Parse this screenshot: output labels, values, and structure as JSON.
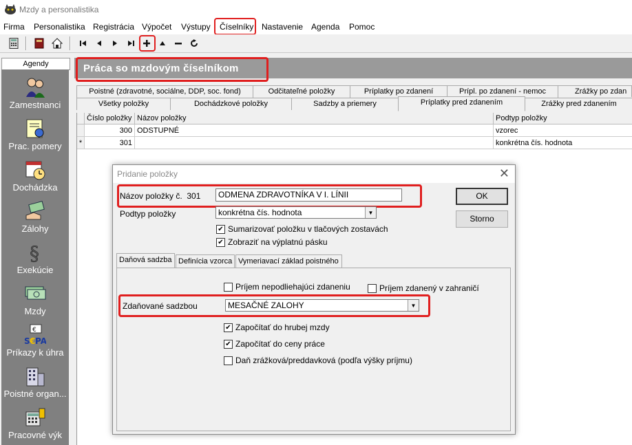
{
  "window": {
    "title": "Mzdy a personalistika"
  },
  "menu": [
    "Firma",
    "Personalistika",
    "Registrácia",
    "Výpočet",
    "Výstupy",
    "Číselníky",
    "Nastavenie",
    "Agenda",
    "Pomoc"
  ],
  "toolbar": {
    "icons": [
      "calculator-icon",
      "book-icon",
      "home-icon",
      "first-record-icon",
      "prev-record-icon",
      "next-record-icon",
      "last-record-icon",
      "add-record-icon",
      "up-record-icon",
      "delete-record-icon",
      "refresh-icon"
    ]
  },
  "sidebar": {
    "header": "Agendy",
    "items": [
      {
        "label": "Zamestnanci",
        "icon": "people-icon"
      },
      {
        "label": "Prac. pomery",
        "icon": "contract-icon"
      },
      {
        "label": "Dochádzka",
        "icon": "calendar-clock-icon"
      },
      {
        "label": "Zálohy",
        "icon": "money-hand-icon"
      },
      {
        "label": "Exekúcie",
        "icon": "paragraph-icon"
      },
      {
        "label": "Mzdy",
        "icon": "banknotes-icon"
      },
      {
        "label": "Príkazy k úhra",
        "icon": "sepa-icon"
      },
      {
        "label": "Poistné organ...",
        "icon": "building-icon"
      },
      {
        "label": "Pracovné výk",
        "icon": "calculator-phone-icon"
      }
    ]
  },
  "main": {
    "title": "Práca so mzdovým číselníkom",
    "tabs_row1": [
      "Poistné (zdravotné, sociálne, DDP, soc. fond)",
      "Odčitateľné položky",
      "Príplatky po zdanení",
      "Prípl. po zdanení - nemoc",
      "Zrážky po zdan"
    ],
    "tabs_row2": [
      "Všetky položky",
      "Dochádzkové položky",
      "Sadzby a priemery",
      "Príplatky pred zdanením",
      "Zrážky pred zdanením"
    ],
    "grid": {
      "columns": [
        "Číslo položky",
        "Názov položky",
        "Podtyp položky"
      ],
      "rows": [
        {
          "marker": "",
          "cislo": "300",
          "nazov": "ODSTUPNÉ",
          "podtyp": "vzorec"
        },
        {
          "marker": "*",
          "cislo": "301",
          "nazov": "",
          "podtyp": "konkrétna čís. hodnota"
        }
      ]
    }
  },
  "dialog": {
    "title": "Pridanie položky",
    "nazov_label": "Názov položky č.",
    "nazov_cislo": "301",
    "nazov_value": "ODMENA ZDRAVOTNÍKA V I. LÍNII",
    "podtyp_label": "Podtyp položky",
    "podtyp_value": "konkrétna čís. hodnota",
    "chk_sumarizovat": {
      "label": "Sumarizovať položku v tlačových zostavách",
      "checked": true
    },
    "chk_zobrazit": {
      "label": "Zobraziť na výplatnú pásku",
      "checked": true
    },
    "ok_label": "OK",
    "storno_label": "Storno",
    "tabs": [
      "Daňová sadzba",
      "Definícia vzorca",
      "Vymeriavací základ poistného"
    ],
    "chk_prijem_nepodl": {
      "label": "Príjem nepodliehajúci zdaneniu",
      "checked": false
    },
    "chk_prijem_zahr": {
      "label": "Príjem zdanený v zahraničí",
      "checked": false
    },
    "sadzba_label": "Zdaňované sadzbou",
    "sadzba_value": "MESAČNÉ ZALOHY",
    "chk_hruba": {
      "label": "Započítať do hrubej mzdy",
      "checked": true
    },
    "chk_cena": {
      "label": "Započítať do ceny práce",
      "checked": true
    },
    "chk_dan": {
      "label": "Daň zrážková/preddavková (podľa výšky príjmu)",
      "checked": false
    }
  },
  "colors": {
    "highlight": "#e01e1e",
    "sidebar_bg": "#808080",
    "title_bar_bg": "#9a9a9a"
  }
}
